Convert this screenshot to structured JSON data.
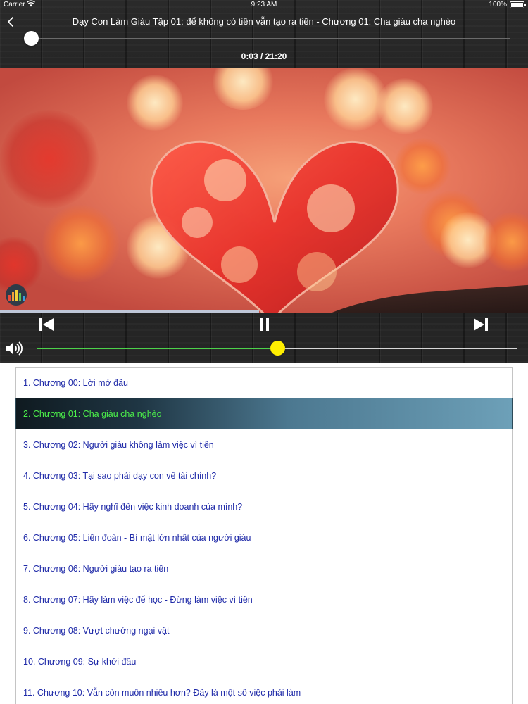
{
  "status_bar": {
    "carrier": "Carrier",
    "time": "9:23 AM",
    "battery": "100%"
  },
  "header": {
    "title": "Dạy Con Làm Giàu Tập 01: để không có tiền vẫn tạo ra tiền -  Chương 01: Cha giàu cha nghèo",
    "time_readout": "0:03 / 21:20"
  },
  "playback": {
    "position_fraction": 0.0023,
    "artwork_progress_fraction": 0.49,
    "volume_fraction": 0.5
  },
  "icons": {
    "back": "chevron-left-icon",
    "prev": "skip-previous-icon",
    "pause": "pause-icon",
    "next": "skip-next-icon",
    "volume": "speaker-icon",
    "equalizer": "equalizer-icon"
  },
  "colors": {
    "active_text": "#4cf04a",
    "list_text": "#1f2aa8",
    "volume_level": "#4cd24a",
    "volume_knob": "#ffee00"
  },
  "chapters": [
    {
      "label": "1. Chương 00: Lời mở đầu",
      "active": false
    },
    {
      "label": "2. Chương 01: Cha giàu cha nghèo",
      "active": true
    },
    {
      "label": "3. Chương 02: Người giàu không làm  việc vì tiền",
      "active": false
    },
    {
      "label": "4. Chương 03: Tại sao phải dạy con về tài chính?",
      "active": false
    },
    {
      "label": "5. Chương 04: Hãy nghĩ đến việc kinh doanh của mình?",
      "active": false
    },
    {
      "label": "6. Chương 05: Liên đoàn - Bí mật lớn nhất của người giàu",
      "active": false
    },
    {
      "label": "7. Chương 06: Người giàu tạo ra tiền",
      "active": false
    },
    {
      "label": "8. Chương 07: Hãy làm việc để học - Đừng làm việc vì tiền",
      "active": false
    },
    {
      "label": "9. Chương 08: Vượt chướng ngại vật",
      "active": false
    },
    {
      "label": "10. Chương 09: Sự khởi đầu",
      "active": false
    },
    {
      "label": "11. Chương 10: Vẫn còn muốn nhiều hơn? Đây là một số việc phải làm",
      "active": false
    }
  ]
}
